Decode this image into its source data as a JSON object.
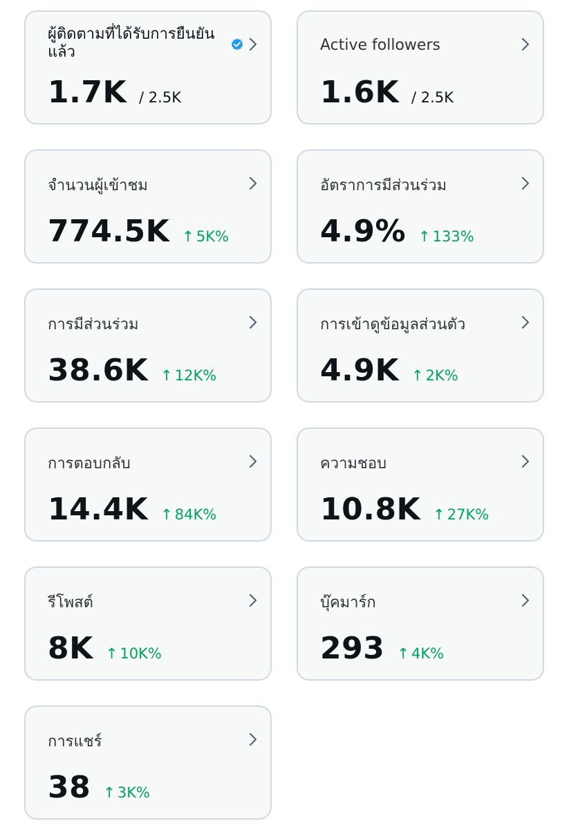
{
  "cards": [
    {
      "title": "ผู้ติดตามที่ได้รับการยืนยันแล้ว",
      "value": "1.7K",
      "sub": "/ 2.5K",
      "verified": true
    },
    {
      "title": "Active followers",
      "value": "1.6K",
      "sub": "/ 2.5K"
    },
    {
      "title": "จำนวนผู้เข้าชม",
      "value": "774.5K",
      "trend": "5K%"
    },
    {
      "title": "อัตราการมีส่วนร่วม",
      "value": "4.9%",
      "trend": "133%"
    },
    {
      "title": "การมีส่วนร่วม",
      "value": "38.6K",
      "trend": "12K%"
    },
    {
      "title": "การเข้าดูข้อมูลส่วนตัว",
      "value": "4.9K",
      "trend": "2K%"
    },
    {
      "title": "การตอบกลับ",
      "value": "14.4K",
      "trend": "84K%"
    },
    {
      "title": "ความชอบ",
      "value": "10.8K",
      "trend": "27K%"
    },
    {
      "title": "รีโพสต์",
      "value": "8K",
      "trend": "10K%"
    },
    {
      "title": "บุ๊คมาร์ก",
      "value": "293",
      "trend": "4K%"
    },
    {
      "title": "การแชร์",
      "value": "38",
      "trend": "3K%"
    }
  ],
  "icons": {
    "trend": "arrow-up-icon",
    "open": "chevron-right-icon",
    "verified": "verified-badge-icon"
  },
  "colors": {
    "trend_positive": "#00a35c",
    "verified_blue": "#1d9bf0",
    "card_border": "#cfd9de",
    "card_background": "#f7f9f9"
  }
}
